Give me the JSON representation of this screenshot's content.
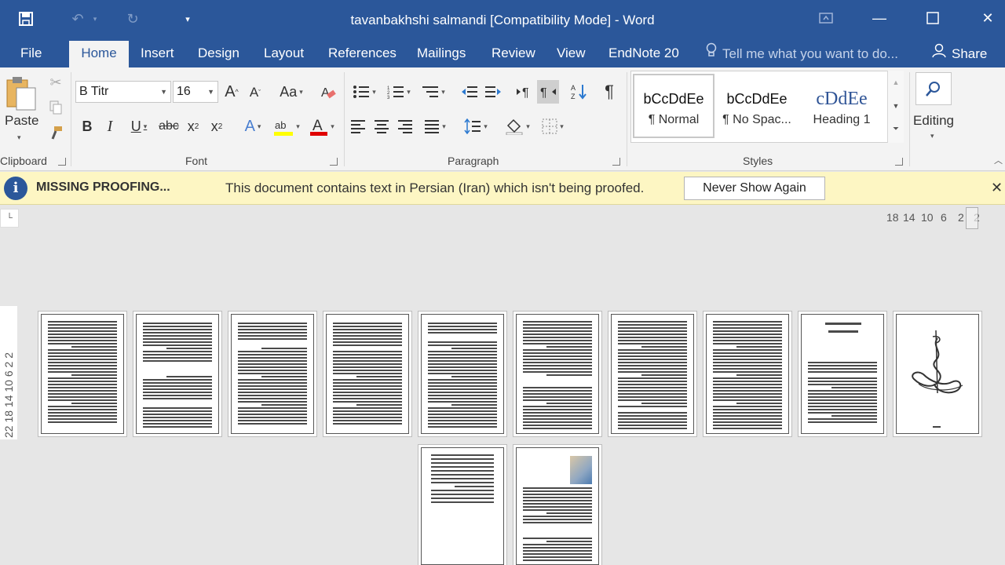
{
  "titlebar": {
    "document_title": "tavanbakhshi salmandi [Compatibility Mode] - Word",
    "save_icon": "save-icon",
    "undo_icon": "undo-icon",
    "redo_icon": "redo-icon",
    "customize_icon": "customize-qat-icon"
  },
  "tabs": [
    {
      "label": "File"
    },
    {
      "label": "Home"
    },
    {
      "label": "Insert"
    },
    {
      "label": "Design"
    },
    {
      "label": "Layout"
    },
    {
      "label": "References"
    },
    {
      "label": "Mailings"
    },
    {
      "label": "Review"
    },
    {
      "label": "View"
    },
    {
      "label": "EndNote 20"
    }
  ],
  "tell_me": "Tell me what you want to do...",
  "share_label": "Share",
  "ribbon": {
    "clipboard": {
      "paste_label": "Paste",
      "group_label": "Clipboard"
    },
    "font": {
      "font_name": "B Titr",
      "font_size": "16",
      "change_case": "Aa",
      "group_label": "Font"
    },
    "paragraph": {
      "group_label": "Paragraph"
    },
    "styles": {
      "group_label": "Styles",
      "items": [
        {
          "sample": "bCcDdEe",
          "name": "¶ Normal"
        },
        {
          "sample": "bCcDdEe",
          "name": "¶ No Spac..."
        },
        {
          "sample": "cDdEe",
          "name": "Heading 1"
        }
      ]
    },
    "editing": {
      "label": "Editing"
    }
  },
  "infobar": {
    "title": "MISSING PROOFING...",
    "message": "This document contains text in Persian (Iran) which isn't being proofed.",
    "button": "Never Show Again"
  },
  "ruler": {
    "horizontal": [
      "18",
      "14",
      "10",
      "6",
      "2",
      "2"
    ],
    "vertical": "22 18 14 10 6 2 2"
  },
  "colors": {
    "accent": "#2b579a",
    "infobar_bg": "#fdf6c3",
    "highlight": "#ffff00",
    "font_color": "#e00000"
  }
}
